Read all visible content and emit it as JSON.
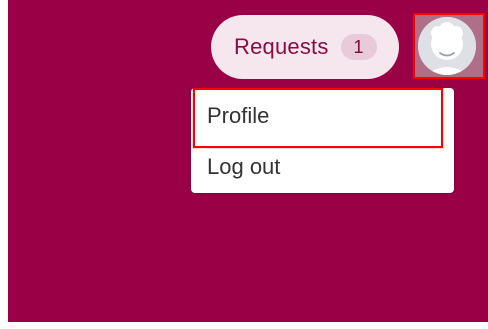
{
  "colors": {
    "background": "#990046",
    "highlight": "#ff0000",
    "pill_background": "#f6e7ee",
    "pill_text": "#8b0b45",
    "badge_background": "#e8cad8",
    "menu_background": "#ffffff",
    "menu_text": "#333333"
  },
  "header": {
    "requests_label": "Requests",
    "requests_count": "1"
  },
  "avatar": {
    "icon": "user-avatar-icon"
  },
  "menu": {
    "items": [
      {
        "label": "Profile"
      },
      {
        "label": "Log out"
      }
    ]
  }
}
